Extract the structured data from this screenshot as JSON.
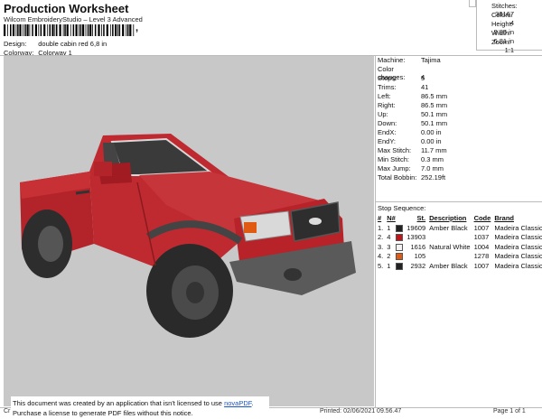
{
  "header": {
    "title": "Production Worksheet",
    "software": "Wilcom EmbroideryStudio – Level 3 Advanced",
    "barcode_tail": ","
  },
  "design_meta": [
    {
      "label": "Design:",
      "value": "double cabin red 6,8 in"
    },
    {
      "label": "Colorway:",
      "value": "Colorway 1"
    }
  ],
  "stats": [
    {
      "label": "Stitches:",
      "value": "38167"
    },
    {
      "label": "Colors:",
      "value": "4"
    },
    {
      "label": "Height:",
      "value": "3.95 in"
    },
    {
      "label": "Width:",
      "value": "6.81 in"
    },
    {
      "label": "Zoom:",
      "value": "1:1"
    }
  ],
  "machine_info": [
    {
      "label": "Machine:",
      "value": "Tajima"
    },
    {
      "label": "Color changes:",
      "value": "4"
    },
    {
      "label": "Stops:",
      "value": "5"
    },
    {
      "label": "Trims:",
      "value": "41"
    },
    {
      "label": "Left:",
      "value": "86.5 mm"
    },
    {
      "label": "Right:",
      "value": "86.5 mm"
    },
    {
      "label": "Up:",
      "value": "50.1 mm"
    },
    {
      "label": "Down:",
      "value": "50.1 mm"
    },
    {
      "label": "EndX:",
      "value": "0.00 in"
    },
    {
      "label": "EndY:",
      "value": "0.00 in"
    },
    {
      "label": "Max Stitch:",
      "value": "11.7 mm"
    },
    {
      "label": "Min Stitch:",
      "value": "0.3 mm"
    },
    {
      "label": "Max Jump:",
      "value": "7.0 mm"
    },
    {
      "label": "Total Bobbin:",
      "value": "252.19ft"
    }
  ],
  "stop_sequence": {
    "title": "Stop Sequence:",
    "headers": [
      "#",
      "N#",
      "St.",
      "Description",
      "Code",
      "Brand"
    ],
    "rows": [
      {
        "stop": "1.",
        "n": "1",
        "color": "#222222",
        "st": "19609",
        "desc": "Amber Black",
        "code": "1007",
        "brand": "Madeira Classic 40"
      },
      {
        "stop": "2.",
        "n": "4",
        "color": "#c0151b",
        "st": "13903",
        "desc": "",
        "code": "1037",
        "brand": "Madeira Classic 40"
      },
      {
        "stop": "3.",
        "n": "3",
        "color": "#f2f2f2",
        "st": "1616",
        "desc": "Natural White",
        "code": "1004",
        "brand": "Madeira Classic 40"
      },
      {
        "stop": "4.",
        "n": "2",
        "color": "#e05a12",
        "st": "105",
        "desc": "",
        "code": "1278",
        "brand": "Madeira Classic 40"
      },
      {
        "stop": "5.",
        "n": "1",
        "color": "#222222",
        "st": "2932",
        "desc": "Amber Black",
        "code": "1007",
        "brand": "Madeira Classic 40"
      }
    ]
  },
  "footer": {
    "notice_line1": "This document was created by an application that isn't licensed to use ",
    "notice_link": "novaPDF",
    "notice_line1_end": ".",
    "notice_line2": "Purchase a license to generate PDF files without this notice.",
    "cr_label": "Cr",
    "printed": "Printed: 02/06/2021 09.56.47",
    "page": "Page 1 of 1"
  }
}
